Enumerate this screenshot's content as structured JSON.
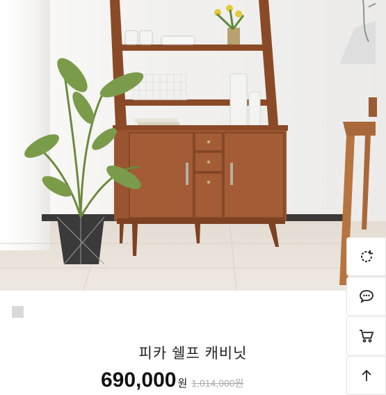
{
  "product": {
    "title": "피카 쉘프 캐비닛",
    "price": "690,000",
    "price_unit": "원",
    "original_price": "1,014,000원"
  },
  "side_buttons": [
    {
      "icon": "refresh-icon"
    },
    {
      "icon": "chat-icon"
    },
    {
      "icon": "cart-icon"
    },
    {
      "icon": "arrow-up-icon"
    }
  ],
  "colors": {
    "wood": "#8a4a28",
    "wood_dark": "#6b371c",
    "accent_text": "#111111"
  }
}
